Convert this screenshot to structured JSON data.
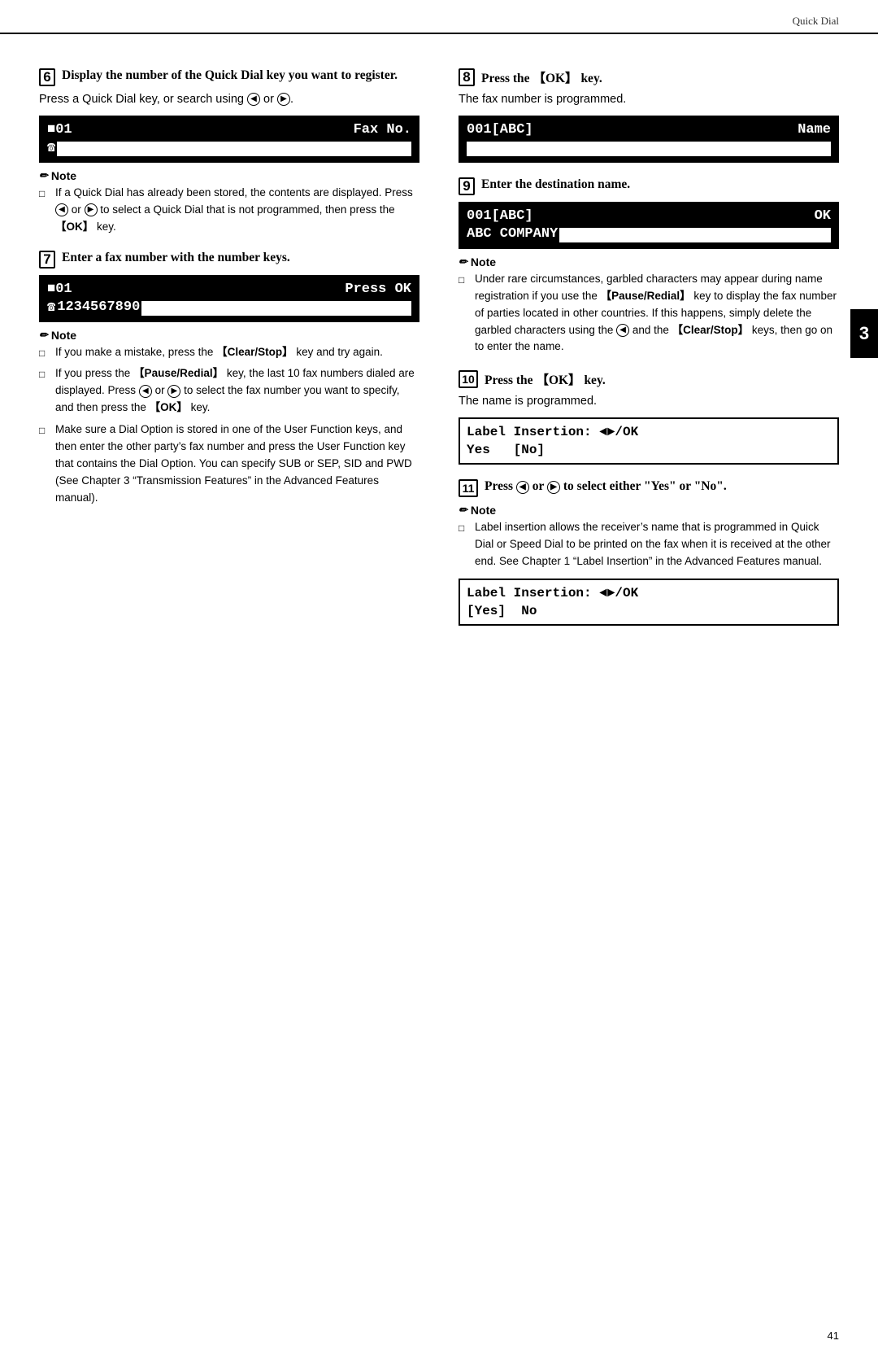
{
  "header": {
    "title": "Quick Dial"
  },
  "page_number": "41",
  "sidebar_tab": "3",
  "steps": {
    "step6": {
      "number": "6",
      "heading": "Display the number of the Quick Dial key you want to register.",
      "body": "Press a Quick Dial key, or search using ⓐ or ⓑ.",
      "lcd": {
        "row1_left": "\u000101",
        "row1_right": "Fax No.",
        "row2_icon": "☎",
        "row2_bar": "████████████████"
      },
      "note": {
        "heading": "Note",
        "items": [
          "If a Quick Dial has already been stored, the contents are displayed. Press ⓐ or ⓑ to select a Quick Dial that is not programmed, then press the 【OK】 key."
        ]
      }
    },
    "step7": {
      "number": "7",
      "heading": "Enter a fax number with the number keys.",
      "lcd": {
        "row1_left": "\u000101",
        "row1_right": "Press OK",
        "row2_icon": "☎",
        "row2_number": "1234567890",
        "row2_bar": "████████"
      },
      "note": {
        "heading": "Note",
        "items": [
          "If you make a mistake, press the 【Clear/Stop】 key and try again.",
          "If you press the 【Pause/Redial】 key, the last 10 fax numbers dialed are displayed. Press ⓐ or ⓑ to select the fax number you want to specify, and then press the 【OK】 key.",
          "Make sure a Dial Option is stored in one of the User Function keys, and then enter the other party’s fax number and press the User Function key that contains the Dial Option. You can specify SUB or SEP, SID and PWD (See Chapter 3 “Transmission Features” in the Advanced Features manual)."
        ]
      }
    },
    "step8": {
      "number": "8",
      "heading": "Press the 【OK】 key.",
      "body": "The fax number is programmed.",
      "lcd": {
        "row1_left": "001[ABC]",
        "row1_right": "Name",
        "row2_bar": "███████████████████"
      }
    },
    "step9": {
      "number": "9",
      "heading": "Enter the destination name.",
      "lcd": {
        "row1_left": "001[ABC]",
        "row1_right": "OK",
        "row2_text": "ABC COMPANY",
        "row2_bar": "█████████"
      },
      "note": {
        "heading": "Note",
        "items": [
          "Under rare circumstances, garbled characters may appear during name registration if you use the 【Pause/Redial】 key to display the fax number of parties located in other countries. If this happens, simply delete the garbled characters using the ⓐ and the 【Clear/Stop】 keys, then go on to enter the name."
        ]
      }
    },
    "step10": {
      "number": "10",
      "heading": "Press the 【OK】 key.",
      "body": "The name is programmed.",
      "lcd": {
        "row1": "Label Insertion: ◄►/OK",
        "row2": "Yes   [No]"
      }
    },
    "step11": {
      "number": "11",
      "heading": "Press ⓐ or ⓑ to select either \"Yes\" or \"No\".",
      "note": {
        "heading": "Note",
        "items": [
          "Label insertion allows the receiver’s name that is programmed in Quick Dial or Speed Dial to be printed on the fax when it is received at the other end. See Chapter 1 “Label Insertion” in the Advanced Features manual."
        ]
      },
      "lcd2": {
        "row1": "Label Insertion: ◄►/OK",
        "row2": "[Yes]  No"
      }
    }
  }
}
